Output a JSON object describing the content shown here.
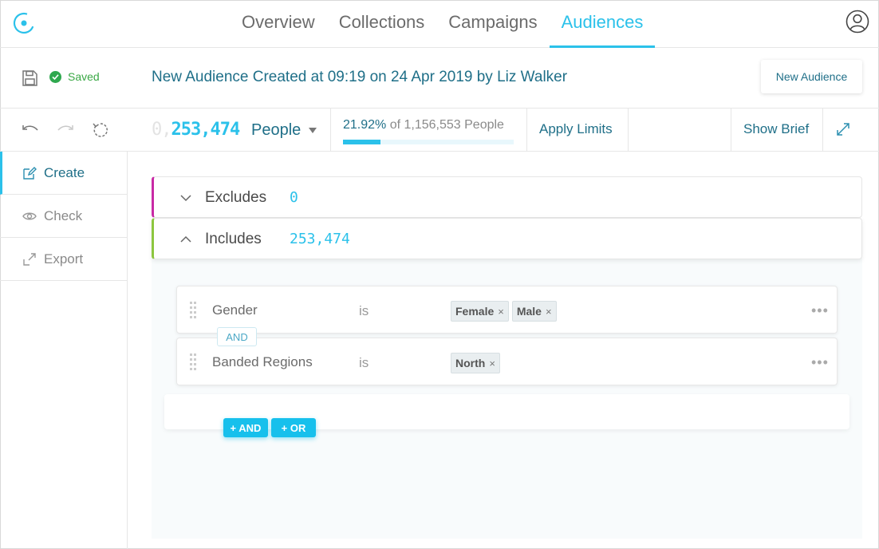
{
  "nav": {
    "tabs": [
      {
        "label": "Overview"
      },
      {
        "label": "Collections"
      },
      {
        "label": "Campaigns"
      },
      {
        "label": "Audiences"
      }
    ],
    "active_tab": "Audiences",
    "logo_icon": "logo-icon",
    "user_icon": "user-icon"
  },
  "header": {
    "saved_label": "Saved",
    "title": "New Audience Created at 09:19 on 24 Apr 2019 by Liz Walker",
    "new_audience_label": "New Audience"
  },
  "toolbar": {
    "count_ghost": "0,",
    "count": "253,474",
    "unit_selector": "People",
    "pct_value": "21.92%",
    "pct_rest": " of 1,156,553 People",
    "pct_fraction": 0.2192,
    "apply_limits_label": "Apply Limits",
    "show_brief_label": "Show Brief"
  },
  "sidebar": {
    "items": [
      {
        "label": "Create",
        "icon": "edit-icon",
        "active": true
      },
      {
        "label": "Check",
        "icon": "eye-icon",
        "active": false
      },
      {
        "label": "Export",
        "icon": "export-icon",
        "active": false
      }
    ]
  },
  "groups": {
    "excludes": {
      "label": "Excludes",
      "count": "0"
    },
    "includes": {
      "label": "Includes",
      "count": "253,474"
    }
  },
  "rules": [
    {
      "field": "Gender",
      "operator": "is",
      "values": [
        "Female",
        "Male"
      ]
    },
    {
      "field": "Banded Regions",
      "operator": "is",
      "values": [
        "North"
      ]
    }
  ],
  "connector_label": "AND",
  "add_buttons": {
    "and": "+ AND",
    "or": "+ OR"
  },
  "colors": {
    "accent": "#2bc1ea",
    "title": "#1f6f88",
    "saved": "#2fa84f",
    "excludes_border": "#c82aa5",
    "includes_border": "#8dc63f"
  }
}
